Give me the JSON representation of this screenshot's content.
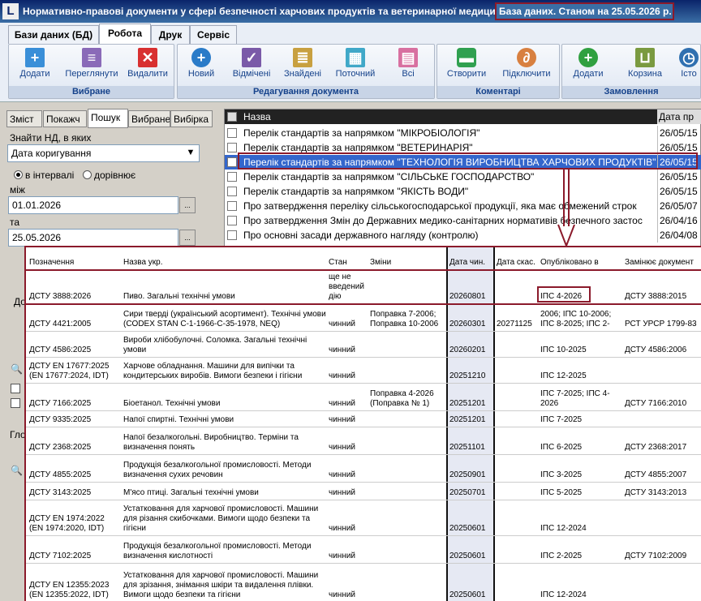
{
  "window": {
    "icon_glyph": "L",
    "title": "Нормативно-правові документи у сфері безпечності харчових продуктів та ветеринарної медицини",
    "db_date": "База даних. Станом на 25.05.2026 р."
  },
  "tabs": [
    "Бази даних (БД)",
    "Робота",
    "Друк",
    "Сервіс"
  ],
  "groups": [
    {
      "label": "Вибране",
      "buttons": [
        "Додати",
        "Переглянути",
        "Видалити"
      ]
    },
    {
      "label": "Редагування документа",
      "buttons": [
        "Новий",
        "Відмічені",
        "Знайдені",
        "Поточний",
        "Всі"
      ]
    },
    {
      "label": "Коментарі",
      "buttons": [
        "Створити",
        "Підключити"
      ]
    },
    {
      "label": "Замовлення",
      "buttons": [
        "Додати",
        "Корзина",
        "Істо"
      ]
    }
  ],
  "left": {
    "tabs": [
      "Зміст",
      "Покажч",
      "Пошук",
      "Вибране",
      "Вибірка"
    ],
    "find_label": "Знайти НД, в яких",
    "find_value": "Дата коригування",
    "radio_interval": "в інтервалі",
    "radio_equal": "дорівнює",
    "between_label": "між",
    "from_date": "01.01.2026",
    "and_label": "та",
    "to_date": "25.05.2026",
    "dots": "...",
    "partial1": "До",
    "partial2": "Гло"
  },
  "list": {
    "col_name": "Назва",
    "col_date": "Дата пр",
    "rows": [
      {
        "title": "Перелік стандартів за напрямком \"МІКРОБІОЛОГІЯ\"",
        "date": "26/05/15"
      },
      {
        "title": "Перелік стандартів за напрямком \"ВЕТЕРИНАРІЯ\"",
        "date": "26/05/15"
      },
      {
        "title": "Перелік стандартів за напрямком \"ТЕХНОЛОГІЯ ВИРОБНИЦТВА ХАРЧОВИХ ПРОДУКТІВ\"",
        "date": "26/05/15"
      },
      {
        "title": "Перелік стандартів за напрямком \"СІЛЬСЬКЕ ГОСПОДАРСТВО\"",
        "date": "26/05/15"
      },
      {
        "title": "Перелік стандартів за напрямком \"ЯКІСТЬ ВОДИ\"",
        "date": "26/05/15"
      },
      {
        "title": "Про затвердження переліку сільськогосподарської продукції, яка має обмежений строк",
        "date": "26/05/07"
      },
      {
        "title": "Про затвердження Змін до Державних медико-санітарних нормативів безпечного застос",
        "date": "26/04/16"
      },
      {
        "title": "Про основні засади державного нагляду (контролю)",
        "date": "26/04/08"
      }
    ]
  },
  "table": {
    "headers": [
      "Позначення",
      "Назва укр.",
      "Стан",
      "Зміни",
      "Дата чин.",
      "Дата скас.",
      "Опубліковано в",
      "Замінює документ"
    ],
    "rows": [
      {
        "code": "ДСТУ 3888:2026",
        "name": "Пиво. Загальні технічні умови",
        "state": "ще не введений дію",
        "changes": "",
        "date_in": "20260801",
        "date_out": "",
        "pub": "ІПС 4-2026",
        "replaces": "ДСТУ 3888:2015"
      },
      {
        "code": "ДСТУ 4421:2005",
        "name": "Сири тверді (український асортимент). Технічні умови (CODEX STAN C-1-1966-C-35-1978, NEQ)",
        "state": "чинний",
        "changes": "Поправка 7-2006; Поправка 10-2006",
        "date_in": "20260301",
        "date_out": "20271125",
        "pub": "2006; ІПС 10-2006; ІПС 8-2025; ІПС 2-",
        "replaces": "РСТ УРСР 1799-83"
      },
      {
        "code": "ДСТУ 4586:2025",
        "name": "Вироби хлібобулочні. Соломка. Загальні технічні умови",
        "state": "чинний",
        "changes": "",
        "date_in": "20260201",
        "date_out": "",
        "pub": "ІПС 10-2025",
        "replaces": "ДСТУ 4586:2006"
      },
      {
        "code": "ДСТУ EN 17677:2025 (EN 17677:2024, IDT)",
        "name": "Харчове обладнання. Машини для випічки та кондитерських виробів. Вимоги безпеки і гігієни",
        "state": "чинний",
        "changes": "",
        "date_in": "20251210",
        "date_out": "",
        "pub": "ІПС 12-2025",
        "replaces": ""
      },
      {
        "code": "ДСТУ 7166:2025",
        "name": "Біоетанол. Технічні умови",
        "state": "чинний",
        "changes": "Поправка 4-2026 (Поправка № 1)",
        "date_in": "20251201",
        "date_out": "",
        "pub": "ІПС 7-2025; ІПС 4-2026",
        "replaces": "ДСТУ 7166:2010"
      },
      {
        "code": "ДСТУ 9335:2025",
        "name": "Напої спиртні. Технічні умови",
        "state": "чинний",
        "changes": "",
        "date_in": "20251201",
        "date_out": "",
        "pub": "ІПС 7-2025",
        "replaces": ""
      },
      {
        "code": "ДСТУ 2368:2025",
        "name": "Напої безалкогольні. Виробництво. Терміни та визначення понять",
        "state": "чинний",
        "changes": "",
        "date_in": "20251101",
        "date_out": "",
        "pub": "ІПС 6-2025",
        "replaces": "ДСТУ 2368:2017"
      },
      {
        "code": "ДСТУ 4855:2025",
        "name": "Продукція безалкогольної промисловості. Методи визначення сухих речовин",
        "state": "чинний",
        "changes": "",
        "date_in": "20250901",
        "date_out": "",
        "pub": "ІПС 3-2025",
        "replaces": "ДСТУ 4855:2007"
      },
      {
        "code": "ДСТУ 3143:2025",
        "name": "М'ясо птиці. Загальні технічні умови",
        "state": "чинний",
        "changes": "",
        "date_in": "20250701",
        "date_out": "",
        "pub": "ІПС 5-2025",
        "replaces": "ДСТУ 3143:2013"
      },
      {
        "code": "ДСТУ EN 1974:2022 (EN 1974:2020, IDT)",
        "name": "Устатковання для харчової промисловості. Машини для різання скибочками. Вимоги щодо безпеки та гігієни",
        "state": "чинний",
        "changes": "",
        "date_in": "20250601",
        "date_out": "",
        "pub": "ІПС 12-2024",
        "replaces": ""
      },
      {
        "code": "ДСТУ 7102:2025",
        "name": "Продукція безалкогольної промисловості. Методи визначення кислотності",
        "state": "чинний",
        "changes": "",
        "date_in": "20250601",
        "date_out": "",
        "pub": "ІПС 2-2025",
        "replaces": "ДСТУ 7102:2009"
      },
      {
        "code": "ДСТУ EN 12355:2023 (EN 12355:2022, IDT)",
        "name": "Устатковання для харчової промисловості. Машини для зрізання, знімання шкіри та видалення плівки. Вимоги щодо безпеки та гігієни",
        "state": "чинний",
        "changes": "",
        "date_in": "20250601",
        "date_out": "",
        "pub": "ІПС 12-2024",
        "replaces": ""
      }
    ]
  },
  "colors": {
    "highlight": "#8b1a2b",
    "title_bar": "#0a246a"
  },
  "icons": {
    "app": "app-icon",
    "add": "plus-icon",
    "view": "document-icon",
    "delete": "x-icon",
    "new": "plus-circle-icon",
    "marked": "checklist-icon",
    "found": "found-icon",
    "current": "table-icon",
    "all": "all-docs-icon",
    "create": "comment-icon",
    "attach": "paperclip-icon",
    "order_add": "plus-circle-icon",
    "cart": "cart-icon",
    "history": "history-icon"
  }
}
